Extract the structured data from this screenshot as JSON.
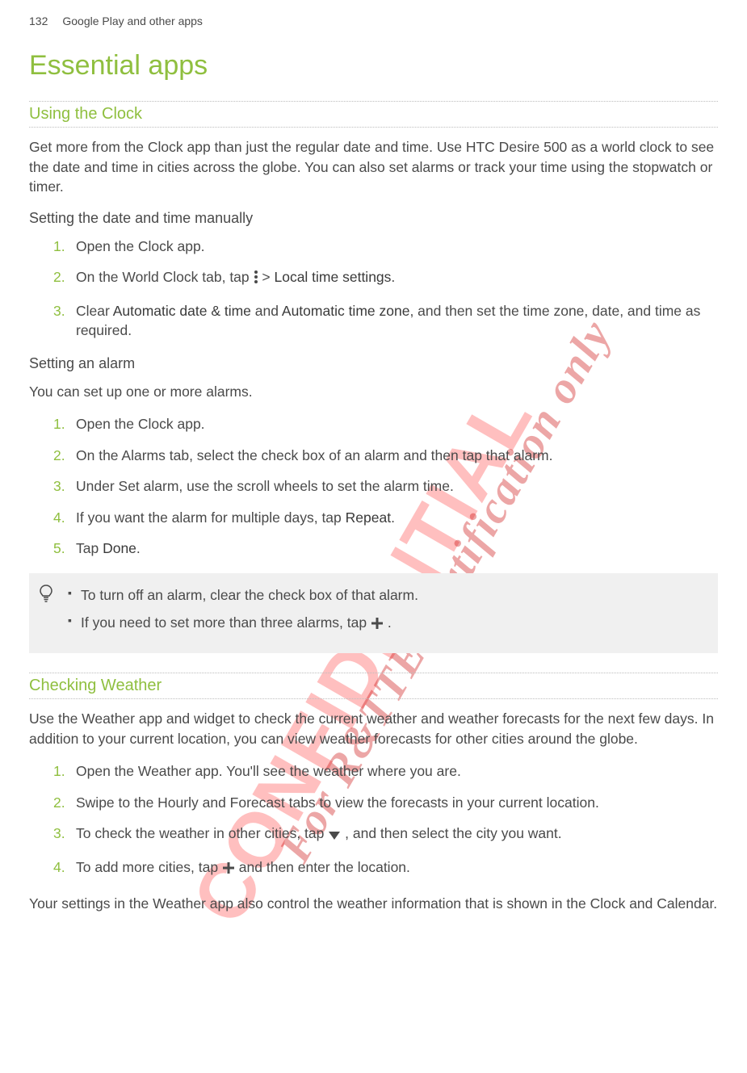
{
  "header": {
    "page_number": "132",
    "breadcrumb": "Google Play and other apps"
  },
  "title": "Essential apps",
  "watermarks": {
    "wm1": "CONFIDENTIAL",
    "wm2": "For R&TTE Certification only"
  },
  "sections": {
    "clock": {
      "heading": "Using the Clock",
      "intro": "Get more from the Clock app than just the regular date and time. Use HTC Desire 500 as a world clock to see the date and time in cities across the globe. You can also set alarms or track your time using the stopwatch or timer.",
      "set_date_time": {
        "heading": "Setting the date and time manually",
        "steps": {
          "s1": "Open the Clock app.",
          "s2_pre": "On the World Clock tab, tap ",
          "s2_post": " > ",
          "s2_bold": "Local time settings",
          "s2_end": ".",
          "s3_pre": "Clear ",
          "s3_b1": "Automatic date & time",
          "s3_mid": " and ",
          "s3_b2": "Automatic time zone",
          "s3_post": ", and then set the time zone, date, and time as required."
        }
      },
      "set_alarm": {
        "heading": "Setting an alarm",
        "intro": "You can set up one or more alarms.",
        "steps": {
          "s1": "Open the Clock app.",
          "s2": "On the Alarms tab, select the check box of an alarm and then tap that alarm.",
          "s3": "Under Set alarm, use the scroll wheels to set the alarm time.",
          "s4_pre": "If you want the alarm for multiple days, tap ",
          "s4_bold": "Repeat",
          "s4_end": ".",
          "s5_pre": "Tap ",
          "s5_bold": "Done",
          "s5_end": "."
        }
      },
      "tips": {
        "t1": "To turn off an alarm, clear the check box of that alarm.",
        "t2_pre": "If you need to set more than three alarms, tap ",
        "t2_end": "."
      }
    },
    "weather": {
      "heading": "Checking Weather",
      "intro": "Use the Weather app and widget to check the current weather and weather forecasts for the next few days. In addition to your current location, you can view weather forecasts for other cities around the globe.",
      "steps": {
        "s1": "Open the Weather app. You'll see the weather where you are.",
        "s2": "Swipe to the Hourly and Forecast tabs to view the forecasts in your current location.",
        "s3_pre": "To check the weather in other cities, tap ",
        "s3_post": ", and then select the city you want.",
        "s4_pre": "To add more cities, tap ",
        "s4_post": " and then enter the location."
      },
      "outro": "Your settings in the Weather app also control the weather information that is shown in the Clock and Calendar."
    }
  },
  "icons": {
    "more_vert": "more-vert-icon",
    "plus": "plus-icon",
    "triangle_down": "triangle-down-icon",
    "bulb": "lightbulb-icon"
  }
}
